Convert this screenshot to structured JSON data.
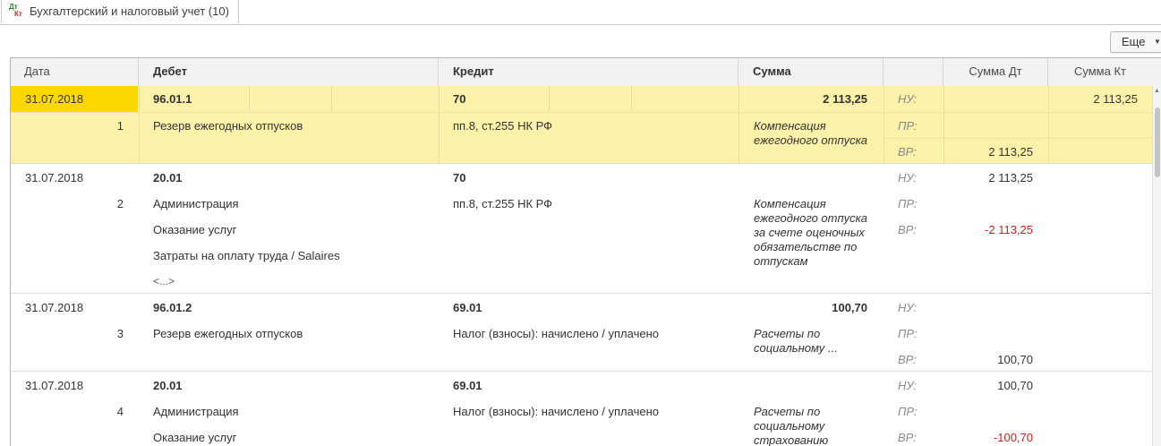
{
  "tab": {
    "title": "Бухгалтерский и налоговый учет (10)",
    "icon_top": "Дт",
    "icon_bottom": "Кт"
  },
  "toolbar": {
    "more_label": "Еще"
  },
  "columns": {
    "date": "Дата",
    "debit": "Дебет",
    "credit": "Кредит",
    "sum": "Сумма",
    "sum_dt": "Сумма Дт",
    "sum_kt": "Сумма Кт"
  },
  "tax_labels": {
    "nu": "НУ:",
    "pr": "ПР:",
    "vr": "ВР:"
  },
  "records": [
    {
      "date": "31.07.2018",
      "num": "1",
      "debit_account": "96.01.1",
      "debit_sub": [
        "Резерв ежегодных отпусков"
      ],
      "credit_account": "70",
      "credit_sub": [
        "пп.8, ст.255 НК РФ"
      ],
      "sum": "2 113,25",
      "content": "Компенсация ежегодного отпуска",
      "nu_dt": "",
      "nu_kt": "2 113,25",
      "pr_dt": "",
      "vr_dt": "2 113,25"
    },
    {
      "date": "31.07.2018",
      "num": "2",
      "debit_account": "20.01",
      "debit_sub": [
        "Администрация",
        "Оказание услуг",
        "Затраты на оплату труда / Salaires",
        "<...>"
      ],
      "credit_account": "70",
      "credit_sub": [
        "пп.8, ст.255 НК РФ"
      ],
      "sum": "",
      "content": "Компенсация ежегодного отпуска за счете оценочных обязательстве по отпускам",
      "nu_dt": "2 113,25",
      "pr_dt": "",
      "vr_dt": "-2 113,25"
    },
    {
      "date": "31.07.2018",
      "num": "3",
      "debit_account": "96.01.2",
      "debit_sub": [
        "Резерв ежегодных отпусков"
      ],
      "credit_account": "69.01",
      "credit_sub": [
        "Налог (взносы): начислено / уплачено"
      ],
      "sum": "100,70",
      "content": "Расчеты по социальному ...",
      "nu_dt": "",
      "pr_dt": "",
      "vr_dt": "100,70"
    },
    {
      "date": "31.07.2018",
      "num": "4",
      "debit_account": "20.01",
      "debit_sub": [
        "Администрация",
        "Оказание услуг"
      ],
      "credit_account": "69.01",
      "credit_sub": [
        "Налог (взносы): начислено / уплачено"
      ],
      "sum": "",
      "content": "Расчеты по социальному страхованию",
      "nu_dt": "100,70",
      "pr_dt": "",
      "vr_dt": "-100,70"
    }
  ],
  "colors": {
    "selected_row": "#fcf1a9",
    "selected_date": "#fcd800",
    "negative": "#d02020"
  }
}
